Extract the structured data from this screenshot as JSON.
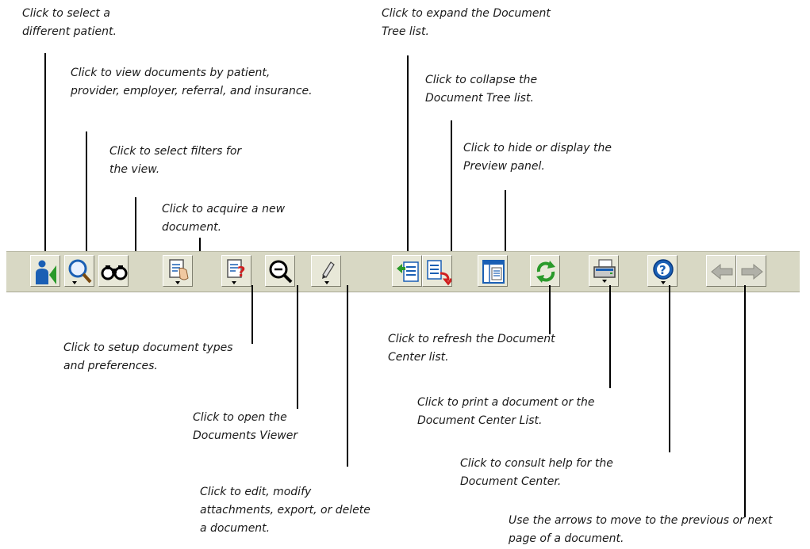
{
  "callouts": {
    "select_patient": [
      "Click to select a",
      "different patient."
    ],
    "view_documents": [
      "Click to view documents by patient,",
      "provider, employer, referral, and insurance."
    ],
    "select_filters": [
      "Click to select filters for",
      "the view."
    ],
    "acquire_document": [
      "Click to acquire a new",
      "document."
    ],
    "expand_tree": [
      "Click to expand the Document",
      "Tree list."
    ],
    "collapse_tree": [
      "Click to collapse the",
      "Document Tree list."
    ],
    "preview_panel": [
      "Click to hide or display the",
      "Preview panel."
    ],
    "setup_types": [
      "Click to setup document types",
      "and preferences."
    ],
    "open_viewer": [
      "Click to open the",
      "Documents Viewer"
    ],
    "edit_document": [
      "Click to edit, modify",
      "attachments, export, or delete",
      "a document."
    ],
    "refresh_list": [
      "Click to refresh the Document",
      "Center list."
    ],
    "print_document": [
      "Click to print a document or the",
      "Document Center List."
    ],
    "consult_help": [
      "Click to consult help for the",
      "Document Center."
    ],
    "arrows": [
      "Use the arrows to move to the previous or next",
      "page of a document."
    ]
  },
  "toolbar": {
    "buttons": [
      {
        "icon": "patient-select-icon",
        "enabled": true
      },
      {
        "icon": "view-by-magnifier-icon",
        "enabled": true
      },
      {
        "icon": "binoculars-filter-icon",
        "enabled": true
      },
      {
        "icon": "acquire-document-hand-icon",
        "enabled": true
      },
      {
        "icon": "setup-document-question-icon",
        "enabled": true
      },
      {
        "icon": "documents-viewer-magnifier-icon",
        "enabled": true
      },
      {
        "icon": "edit-document-pen-icon",
        "enabled": true
      },
      {
        "icon": "expand-tree-icon",
        "enabled": true
      },
      {
        "icon": "collapse-tree-icon",
        "enabled": true
      },
      {
        "icon": "preview-panel-icon",
        "enabled": true
      },
      {
        "icon": "refresh-icon",
        "enabled": true
      },
      {
        "icon": "print-icon",
        "enabled": true
      },
      {
        "icon": "help-icon",
        "enabled": true
      },
      {
        "icon": "previous-page-arrow-icon",
        "enabled": false
      },
      {
        "icon": "next-page-arrow-icon",
        "enabled": false
      }
    ]
  },
  "colors": {
    "toolbar_bg": "#d8d8c4",
    "icon_blue": "#1a5fb4",
    "icon_green": "#2a9a2a",
    "icon_red": "#d02020",
    "disabled_gray": "#b0b0a8"
  }
}
